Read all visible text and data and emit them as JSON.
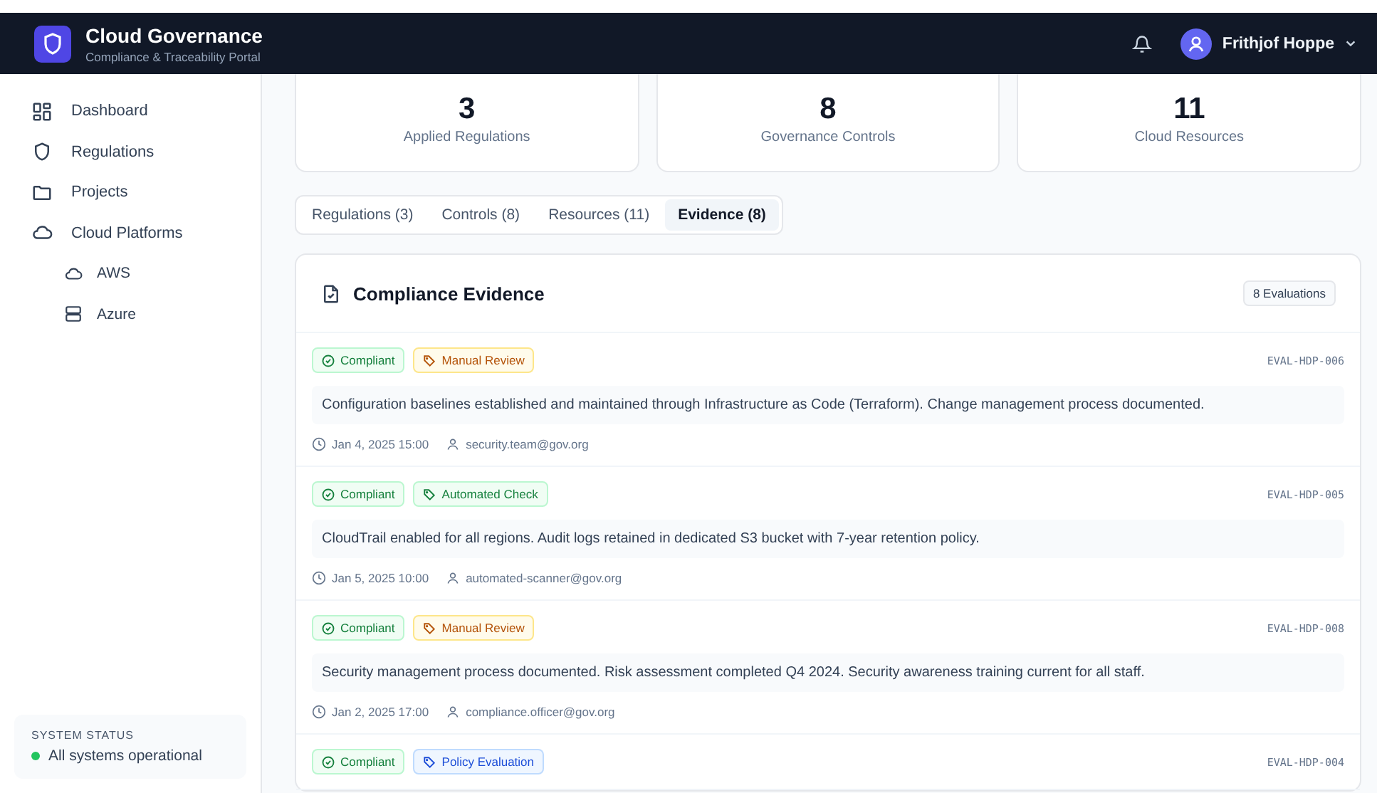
{
  "brand": {
    "title": "Cloud Governance",
    "subtitle": "Compliance & Traceability Portal"
  },
  "user": {
    "name": "Frithjof Hoppe"
  },
  "sidebar": {
    "items": [
      {
        "label": "Dashboard"
      },
      {
        "label": "Regulations"
      },
      {
        "label": "Projects"
      },
      {
        "label": "Cloud Platforms",
        "children": [
          {
            "label": "AWS"
          },
          {
            "label": "Azure"
          }
        ]
      }
    ],
    "status": {
      "title": "SYSTEM STATUS",
      "text": "All systems operational",
      "color": "#22c55e"
    }
  },
  "stats": [
    {
      "value": "3",
      "label": "Applied Regulations"
    },
    {
      "value": "8",
      "label": "Governance Controls"
    },
    {
      "value": "11",
      "label": "Cloud Resources"
    }
  ],
  "tabs": [
    {
      "label": "Regulations (3)",
      "selected": false
    },
    {
      "label": "Controls (8)",
      "selected": false
    },
    {
      "label": "Resources (11)",
      "selected": false
    },
    {
      "label": "Evidence (8)",
      "selected": true
    }
  ],
  "evidence": {
    "title": "Compliance Evidence",
    "count": "8 Evaluations",
    "items": [
      {
        "status": "Compliant",
        "tag": "Manual Review",
        "kind": "manual",
        "id": "EVAL-HDP-006",
        "description": "Configuration baselines established and maintained through Infrastructure as Code (Terraform). Change management process documented.",
        "date": "Jan 4, 2025 15:00",
        "user": "security.team@gov.org"
      },
      {
        "status": "Compliant",
        "tag": "Automated Check",
        "kind": "automated",
        "id": "EVAL-HDP-005",
        "description": "CloudTrail enabled for all regions. Audit logs retained in dedicated S3 bucket with 7-year retention policy.",
        "date": "Jan 5, 2025 10:00",
        "user": "automated-scanner@gov.org"
      },
      {
        "status": "Compliant",
        "tag": "Manual Review",
        "kind": "manual",
        "id": "EVAL-HDP-008",
        "description": "Security management process documented. Risk assessment completed Q4 2024. Security awareness training current for all staff.",
        "date": "Jan 2, 2025 17:00",
        "user": "compliance.officer@gov.org"
      },
      {
        "status": "Compliant",
        "tag": "Policy Evaluation",
        "kind": "policy",
        "id": "EVAL-HDP-004"
      }
    ]
  }
}
